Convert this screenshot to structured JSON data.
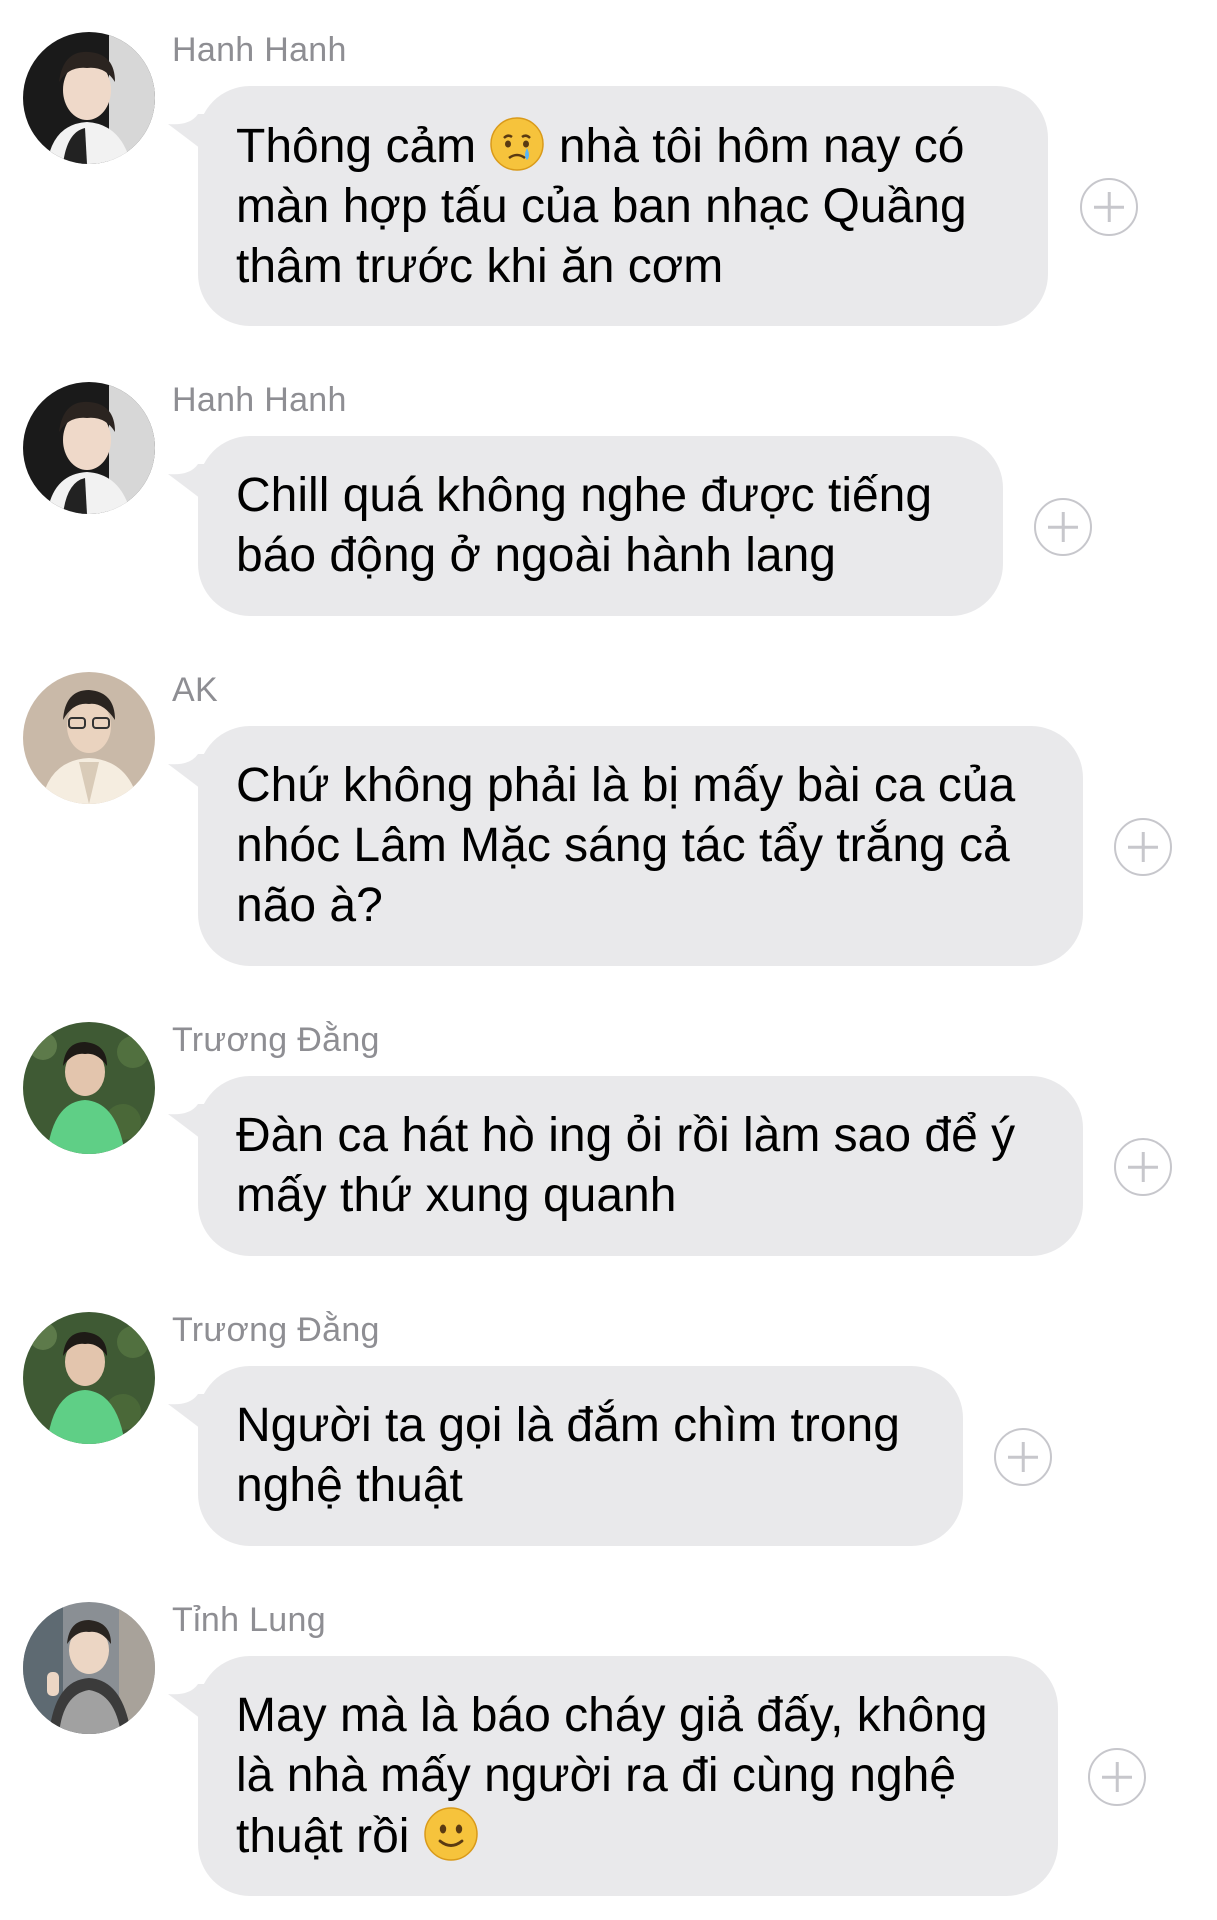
{
  "messages": [
    {
      "sender": "Hanh Hanh",
      "avatar": "avatar-hanh-hanh",
      "lines": [
        "Thông cảm",
        "nhà tôi hôm nay có",
        "màn hợp tấu của ban nhạc Quầng",
        "thâm trước khi ăn cơm"
      ],
      "emoji": "crying-face-emoji"
    },
    {
      "sender": "Hanh Hanh",
      "avatar": "avatar-hanh-hanh",
      "lines": [
        "Chill quá không nghe được tiếng",
        "báo động ở ngoài hành lang"
      ]
    },
    {
      "sender": "AK",
      "avatar": "avatar-ak",
      "lines": [
        "Chứ không phải là bị mấy bài ca của",
        "nhóc Lâm Mặc sáng tác tẩy trắng cả",
        "não à?"
      ]
    },
    {
      "sender": "Trương Đằng",
      "avatar": "avatar-truong-dang",
      "lines": [
        "Đàn ca hát hò ing ỏi rồi làm sao để ý",
        "mấy thứ xung quanh"
      ]
    },
    {
      "sender": "Trương Đằng",
      "avatar": "avatar-truong-dang",
      "lines": [
        "Người ta gọi là đắm chìm trong",
        "nghệ thuật"
      ]
    },
    {
      "sender": "Tỉnh Lung",
      "avatar": "avatar-tinh-lung",
      "lines": [
        "May mà là báo cháy giả đấy, không",
        "là nhà mấy người ra đi cùng nghệ",
        "thuật rồi"
      ],
      "emoji": "slightly-smiling-face-emoji"
    }
  ],
  "colors": {
    "bubble": "#e9e9eb",
    "sender_name": "#8e8e93",
    "add_icon": "#c7c7cc"
  }
}
